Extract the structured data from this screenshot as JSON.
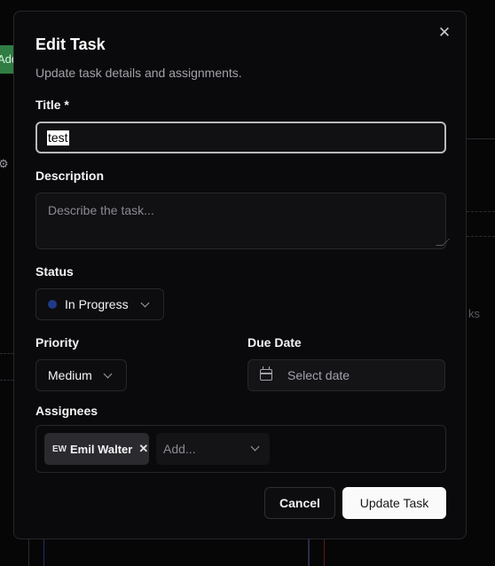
{
  "background": {
    "add_button_label": "Add",
    "side_text": "ks",
    "side_char": "i"
  },
  "dialog": {
    "title": "Edit Task",
    "subtitle": "Update task details and assignments.",
    "close_icon": "close-icon"
  },
  "form": {
    "title_label": "Title *",
    "title_value": "test",
    "description_label": "Description",
    "description_placeholder": "Describe the task...",
    "status_label": "Status",
    "status_value": "In Progress",
    "status_color": "#1e3a8a",
    "priority_label": "Priority",
    "priority_value": "Medium",
    "due_date_label": "Due Date",
    "due_date_placeholder": "Select date",
    "assignees_label": "Assignees",
    "assignees": [
      {
        "initials": "EW",
        "name": "Emil Walter"
      }
    ],
    "assignee_add_placeholder": "Add..."
  },
  "actions": {
    "cancel_label": "Cancel",
    "submit_label": "Update Task"
  }
}
